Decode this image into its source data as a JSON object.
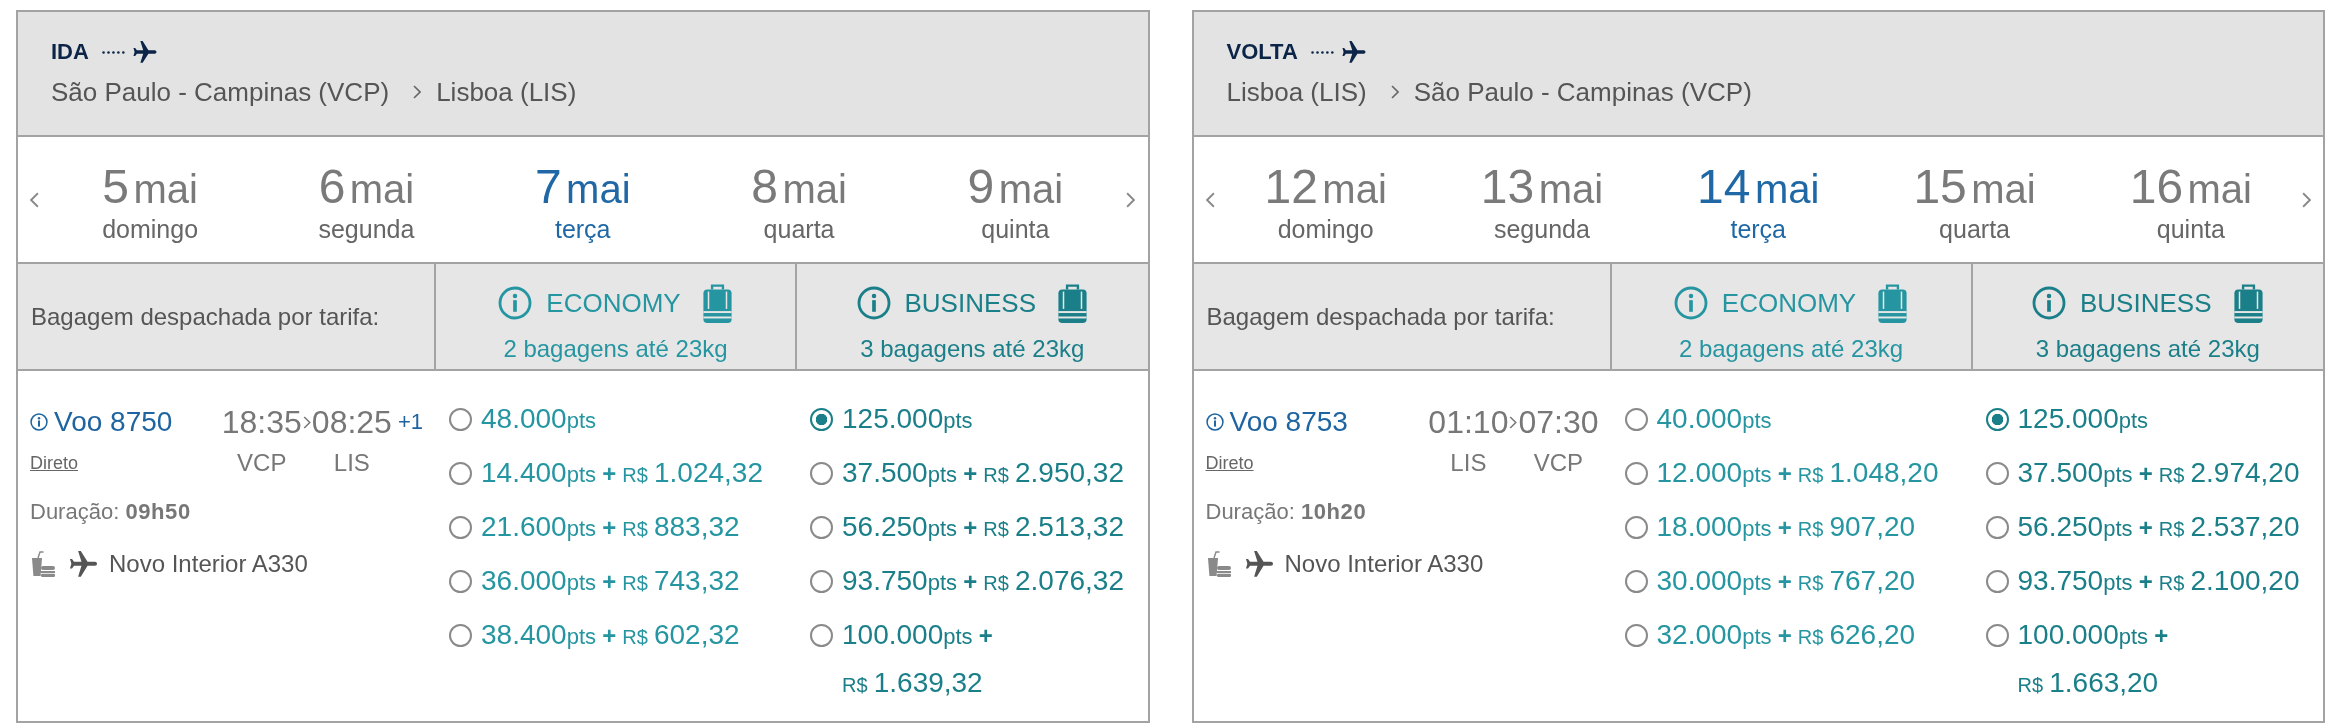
{
  "panels": [
    {
      "direction": "IDA",
      "origin": "São Paulo - Campinas (VCP)",
      "destination": "Lisboa (LIS)",
      "dates": [
        {
          "day": "5",
          "month": "mai",
          "weekday": "domingo",
          "selected": false
        },
        {
          "day": "6",
          "month": "mai",
          "weekday": "segunda",
          "selected": false
        },
        {
          "day": "7",
          "month": "mai",
          "weekday": "terça",
          "selected": true
        },
        {
          "day": "8",
          "month": "mai",
          "weekday": "quarta",
          "selected": false
        },
        {
          "day": "9",
          "month": "mai",
          "weekday": "quinta",
          "selected": false
        }
      ],
      "baggage_label": "Bagagem despachada por tarifa:",
      "flight": {
        "number": "Voo 8750",
        "departure": "18:35",
        "arrival": "08:25",
        "day_offset": "+1",
        "stops": "Direto",
        "from": "VCP",
        "to": "LIS",
        "duration_label": "Duração:",
        "duration": "09h50",
        "aircraft": "Novo Interior A330"
      },
      "fares": [
        {
          "cabin": "ECONOMY",
          "allowance": "2 bagagens até 23kg",
          "color": "#2596a1",
          "options": [
            {
              "kind": "points",
              "points": "48.000",
              "unit": "pts",
              "selected": false
            },
            {
              "kind": "points_cash",
              "points": "14.400",
              "unit": "pts",
              "plus": "+",
              "currency": "R$",
              "amount": "1.024,32",
              "selected": false
            },
            {
              "kind": "points_cash",
              "points": "21.600",
              "unit": "pts",
              "plus": "+",
              "currency": "R$",
              "amount": "883,32",
              "selected": false
            },
            {
              "kind": "points_cash",
              "points": "36.000",
              "unit": "pts",
              "plus": "+",
              "currency": "R$",
              "amount": "743,32",
              "selected": false
            },
            {
              "kind": "points_cash",
              "points": "38.400",
              "unit": "pts",
              "plus": "+",
              "currency": "R$",
              "amount": "602,32",
              "selected": false
            }
          ]
        },
        {
          "cabin": "BUSINESS",
          "allowance": "3 bagagens até 23kg",
          "color": "#1a7f88",
          "options": [
            {
              "kind": "points",
              "points": "125.000",
              "unit": "pts",
              "selected": true
            },
            {
              "kind": "points_cash",
              "points": "37.500",
              "unit": "pts",
              "plus": "+",
              "currency": "R$",
              "amount": "2.950,32",
              "selected": false
            },
            {
              "kind": "points_cash",
              "points": "56.250",
              "unit": "pts",
              "plus": "+",
              "currency": "R$",
              "amount": "2.513,32",
              "selected": false
            },
            {
              "kind": "points_cash",
              "points": "93.750",
              "unit": "pts",
              "plus": "+",
              "currency": "R$",
              "amount": "2.076,32",
              "selected": false
            },
            {
              "kind": "points_cash",
              "points": "100.000",
              "unit": "pts",
              "plus": "+",
              "currency": "R$",
              "amount": "1.639,32",
              "selected": false
            }
          ]
        }
      ]
    },
    {
      "direction": "VOLTA",
      "origin": "Lisboa (LIS)",
      "destination": "São Paulo - Campinas (VCP)",
      "dates": [
        {
          "day": "12",
          "month": "mai",
          "weekday": "domingo",
          "selected": false
        },
        {
          "day": "13",
          "month": "mai",
          "weekday": "segunda",
          "selected": false
        },
        {
          "day": "14",
          "month": "mai",
          "weekday": "terça",
          "selected": true
        },
        {
          "day": "15",
          "month": "mai",
          "weekday": "quarta",
          "selected": false
        },
        {
          "day": "16",
          "month": "mai",
          "weekday": "quinta",
          "selected": false
        }
      ],
      "baggage_label": "Bagagem despachada por tarifa:",
      "flight": {
        "number": "Voo 8753",
        "departure": "01:10",
        "arrival": "07:30",
        "stops": "Direto",
        "from": "LIS",
        "to": "VCP",
        "duration_label": "Duração:",
        "duration": "10h20",
        "aircraft": "Novo Interior A330"
      },
      "fares": [
        {
          "cabin": "ECONOMY",
          "allowance": "2 bagagens até 23kg",
          "color": "#2596a1",
          "options": [
            {
              "kind": "points",
              "points": "40.000",
              "unit": "pts",
              "selected": false
            },
            {
              "kind": "points_cash",
              "points": "12.000",
              "unit": "pts",
              "plus": "+",
              "currency": "R$",
              "amount": "1.048,20",
              "selected": false
            },
            {
              "kind": "points_cash",
              "points": "18.000",
              "unit": "pts",
              "plus": "+",
              "currency": "R$",
              "amount": "907,20",
              "selected": false
            },
            {
              "kind": "points_cash",
              "points": "30.000",
              "unit": "pts",
              "plus": "+",
              "currency": "R$",
              "amount": "767,20",
              "selected": false
            },
            {
              "kind": "points_cash",
              "points": "32.000",
              "unit": "pts",
              "plus": "+",
              "currency": "R$",
              "amount": "626,20",
              "selected": false
            }
          ]
        },
        {
          "cabin": "BUSINESS",
          "allowance": "3 bagagens até 23kg",
          "color": "#1a7f88",
          "options": [
            {
              "kind": "points",
              "points": "125.000",
              "unit": "pts",
              "selected": true
            },
            {
              "kind": "points_cash",
              "points": "37.500",
              "unit": "pts",
              "plus": "+",
              "currency": "R$",
              "amount": "2.974,20",
              "selected": false
            },
            {
              "kind": "points_cash",
              "points": "56.250",
              "unit": "pts",
              "plus": "+",
              "currency": "R$",
              "amount": "2.537,20",
              "selected": false
            },
            {
              "kind": "points_cash",
              "points": "93.750",
              "unit": "pts",
              "plus": "+",
              "currency": "R$",
              "amount": "2.100,20",
              "selected": false
            },
            {
              "kind": "points_cash",
              "points": "100.000",
              "unit": "pts",
              "plus": "+",
              "currency": "R$",
              "amount": "1.663,20",
              "selected": false
            }
          ]
        }
      ]
    }
  ]
}
